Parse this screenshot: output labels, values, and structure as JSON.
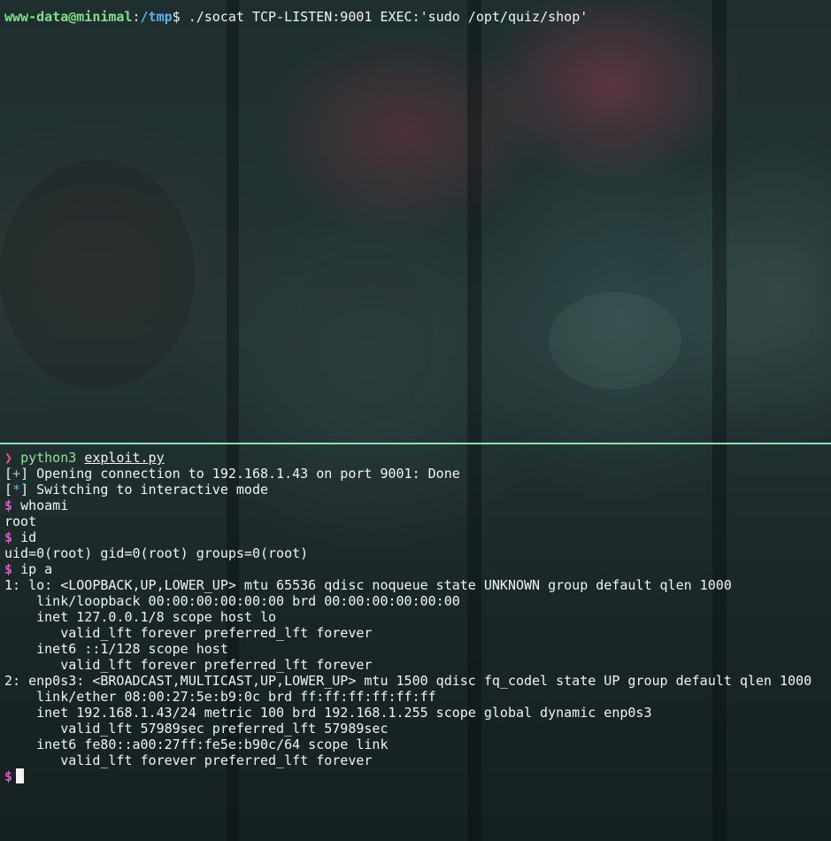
{
  "top_pane": {
    "prompt_user_host": "www-data@minimal",
    "prompt_sep": ":",
    "prompt_path": "/tmp",
    "prompt_end": "$",
    "command": "./socat TCP-LISTEN:9001 EXEC:'sudo /opt/quiz/shop'"
  },
  "bottom_pane": {
    "prompt_char": "❯",
    "py_command": "python3",
    "py_file": "exploit.py",
    "status_lines": [
      {
        "open": "[",
        "mark": "+",
        "close": "]",
        "text": " Opening connection to 192.168.1.43 on port 9001: Done"
      },
      {
        "open": "[",
        "mark": "*",
        "close": "]",
        "text": " Switching to interactive mode"
      }
    ],
    "shell_prompt": "$",
    "commands": {
      "whoami": "whoami",
      "whoami_out": "root",
      "id": "id",
      "id_out": "uid=0(root) gid=0(root) groups=0(root)",
      "ip": "ip a"
    },
    "ip_output": [
      "1: lo: <LOOPBACK,UP,LOWER_UP> mtu 65536 qdisc noqueue state UNKNOWN group default qlen 1000",
      "    link/loopback 00:00:00:00:00:00 brd 00:00:00:00:00:00",
      "    inet 127.0.0.1/8 scope host lo",
      "       valid_lft forever preferred_lft forever",
      "    inet6 ::1/128 scope host",
      "       valid_lft forever preferred_lft forever",
      "2: enp0s3: <BROADCAST,MULTICAST,UP,LOWER_UP> mtu 1500 qdisc fq_codel state UP group default qlen 1000",
      "    link/ether 08:00:27:5e:b9:0c brd ff:ff:ff:ff:ff:ff",
      "    inet 192.168.1.43/24 metric 100 brd 192.168.1.255 scope global dynamic enp0s3",
      "       valid_lft 57989sec preferred_lft 57989sec",
      "    inet6 fe80::a00:27ff:fe5e:b90c/64 scope link",
      "       valid_lft forever preferred_lft forever"
    ]
  },
  "colors": {
    "user_host": "#7fe087",
    "path": "#5ab2f2",
    "prompt_arrow": "#ff4f7b",
    "shell_dollar": "#e255c8",
    "pane_divider": "#8fdfb6"
  }
}
